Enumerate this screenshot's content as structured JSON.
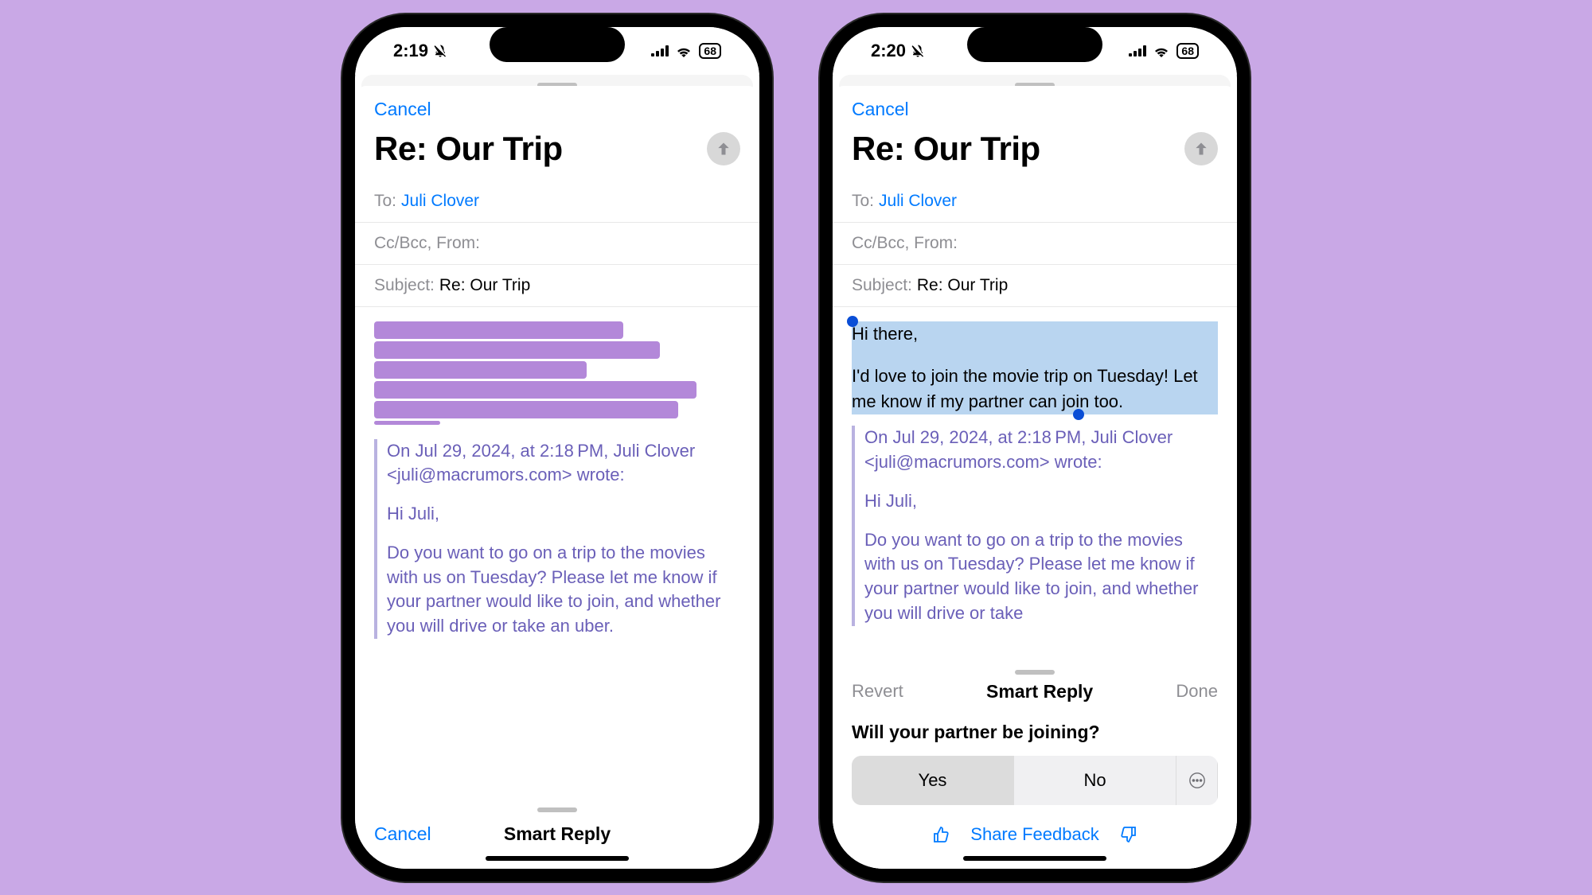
{
  "phones": [
    {
      "status": {
        "time": "2:19",
        "battery": "68"
      },
      "nav": {
        "cancel": "Cancel"
      },
      "title": "Re: Our Trip",
      "fields": {
        "to_label": "To:",
        "to_value": "Juli Clover",
        "cc_label": "Cc/Bcc, From:",
        "subject_label": "Subject:",
        "subject_value": "Re: Our Trip"
      },
      "quoted": {
        "header": "On Jul 29, 2024, at 2:18 PM, Juli Clover <juli@macrumors.com> wrote:",
        "greeting": "Hi Juli,",
        "body": "Do you want to go on a trip to the movies with us on Tuesday? Please let me know if your partner would like to join, and whether you will drive or take an uber."
      },
      "bottom": {
        "cancel": "Cancel",
        "title": "Smart Reply"
      }
    },
    {
      "status": {
        "time": "2:20",
        "battery": "68"
      },
      "nav": {
        "cancel": "Cancel"
      },
      "title": "Re: Our Trip",
      "fields": {
        "to_label": "To:",
        "to_value": "Juli Clover",
        "cc_label": "Cc/Bcc, From:",
        "subject_label": "Subject:",
        "subject_value": "Re: Our Trip"
      },
      "reply": {
        "greeting": "Hi there,",
        "body": "I'd love to join the movie trip on Tuesday! Let me know if my partner can join too."
      },
      "quoted": {
        "header": "On Jul 29, 2024, at 2:18 PM, Juli Clover <juli@macrumors.com> wrote:",
        "greeting": "Hi Juli,",
        "body": "Do you want to go on a trip to the movies with us on Tuesday? Please let me know if your partner would like to join, and whether you will drive or take"
      },
      "panel": {
        "revert": "Revert",
        "title": "Smart Reply",
        "done": "Done",
        "question": "Will your partner be joining?",
        "yes": "Yes",
        "no": "No",
        "feedback_label": "Share Feedback"
      }
    }
  ]
}
